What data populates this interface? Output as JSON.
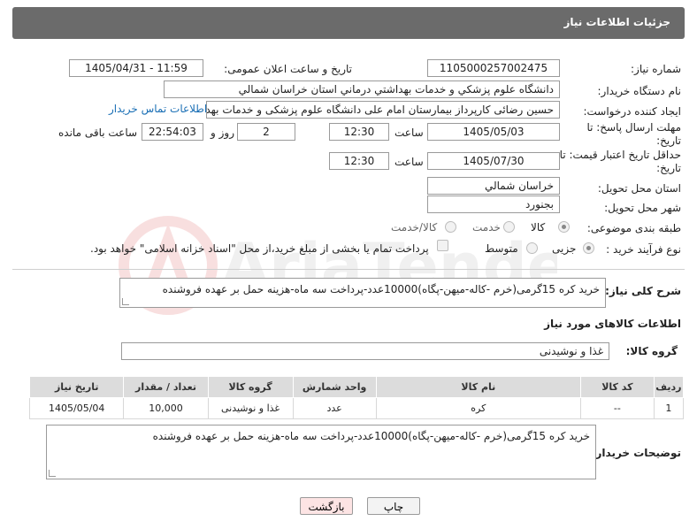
{
  "header": {
    "title": "جزئیات اطلاعات نیاز"
  },
  "fields": {
    "need_number_label": "شماره نیاز:",
    "need_number": "1105000257002475",
    "announce_label": "تاریخ و ساعت اعلان عمومی:",
    "announce_value": "1405/04/31 - 11:59",
    "buyer_org_label": "نام دستگاه خریدار:",
    "buyer_org": "دانشگاه علوم پزشکي و خدمات بهداشتي درماني استان خراسان شمالي",
    "creator_label": "ایجاد کننده درخواست:",
    "creator": "حسین رضائی کارپرداز بیمارستان امام علی دانشگاه علوم پزشکی و خدمات بهد",
    "contact_link": "اطلاعات تماس خریدار",
    "deadline_label": "مهلت ارسال پاسخ: تا تاریخ:",
    "deadline_date": "1405/05/03",
    "time_label": "ساعت",
    "deadline_time": "12:30",
    "days_value": "2",
    "days_label": "روز و",
    "remaining_time": "22:54:03",
    "remaining_label": "ساعت باقی مانده",
    "validity_label": "حداقل تاریخ اعتبار قیمت: تا تاریخ:",
    "validity_date": "1405/07/30",
    "validity_time": "12:30",
    "province_label": "استان محل تحویل:",
    "province": "خراسان شمالي",
    "city_label": "شهر محل تحویل:",
    "city": "بجنورد",
    "category_label": "طبقه بندی موضوعی:",
    "category_options": [
      "کالا",
      "خدمت",
      "کالا/خدمت"
    ],
    "process_label": "نوع فرآیند خرید :",
    "process_options": [
      "جزیی",
      "متوسط"
    ],
    "payment_note": "پرداخت تمام یا بخشی از مبلغ خرید،از محل \"اسناد خزانه اسلامی\" خواهد بود."
  },
  "summary": {
    "label": "شرح کلی نیاز:",
    "text": "خرید کره 15گرمی(خرم -کاله-میهن-پگاه)10000عدد-پرداخت سه ماه-هزینه حمل بر عهده فروشنده"
  },
  "goods_section": {
    "title": "اطلاعات کالاهای مورد نیاز",
    "group_label": "گروه کالا:",
    "group_value": "غذا و نوشیدنی"
  },
  "table": {
    "headers": [
      "ردیف",
      "کد کالا",
      "نام کالا",
      "واحد شمارش",
      "گروه کالا",
      "تعداد / مقدار",
      "تاریخ نیاز"
    ],
    "rows": [
      [
        "1",
        "--",
        "کره",
        "عدد",
        "غذا و نوشیدنی",
        "10,000",
        "1405/05/04"
      ]
    ]
  },
  "buyer_notes": {
    "label": "توضیحات خریدار:",
    "text": "خرید کره 15گرمی(خرم -کاله-میهن-پگاه)10000عدد-پرداخت سه ماه-هزینه حمل بر عهده فروشنده"
  },
  "buttons": {
    "print": "چاپ",
    "back": "بازگشت"
  }
}
